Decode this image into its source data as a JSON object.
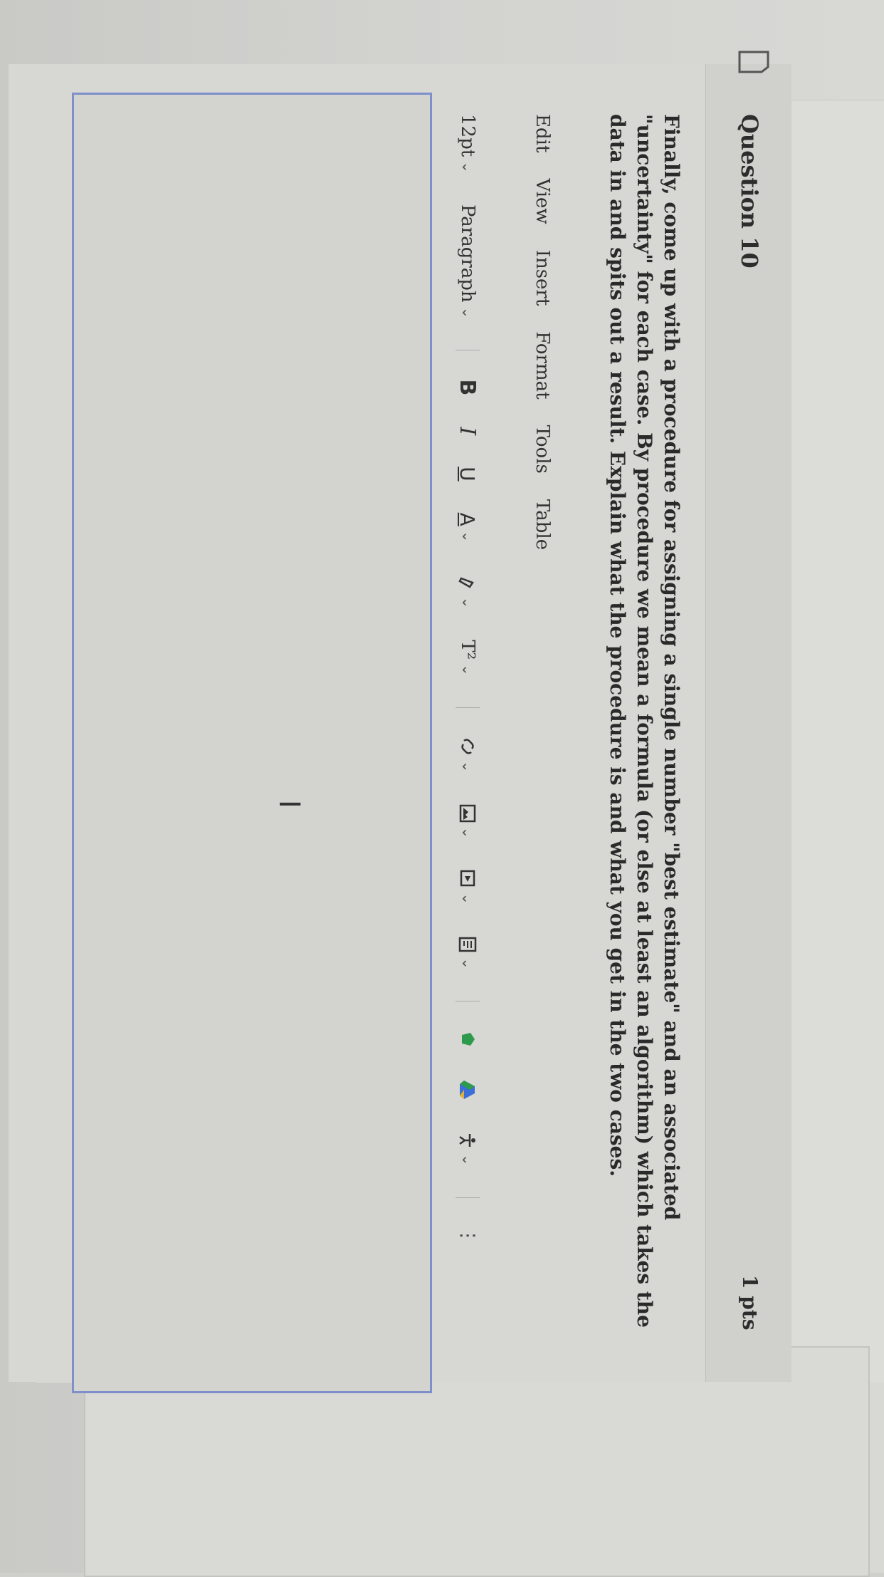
{
  "question": {
    "title": "Question 10",
    "points": "1 pts",
    "text": "Finally, come up with a procedure for assigning a single number \"best estimate\" and an associated \"uncertainty\" for each case. By procedure we mean a formula (or else at least an algorithm) which takes the data in and spits out a result. Explain what the procedure is and what you get in the two cases."
  },
  "menu": {
    "edit": "Edit",
    "view": "View",
    "insert": "Insert",
    "format": "Format",
    "tools": "Tools",
    "table": "Table"
  },
  "toolbar": {
    "font_size": "12pt",
    "block_format": "Paragraph",
    "bold": "B",
    "italic": "I",
    "underline": "U",
    "text_color": "A",
    "superscript": "T²",
    "more": "⋮",
    "chevron": "⌄"
  },
  "icons": {
    "flag": "flag-icon",
    "highlight": "highlighter-icon",
    "link": "link-icon",
    "image": "image-icon",
    "media": "media-icon",
    "document": "document-icon",
    "apps": "apps-icon",
    "drive": "google-drive-icon",
    "accessibility": "accessibility-icon"
  },
  "colors": {
    "editor_border": "#7e8fc9",
    "drive_green": "#2e9a4b",
    "drive_blue": "#3b6fd6"
  }
}
